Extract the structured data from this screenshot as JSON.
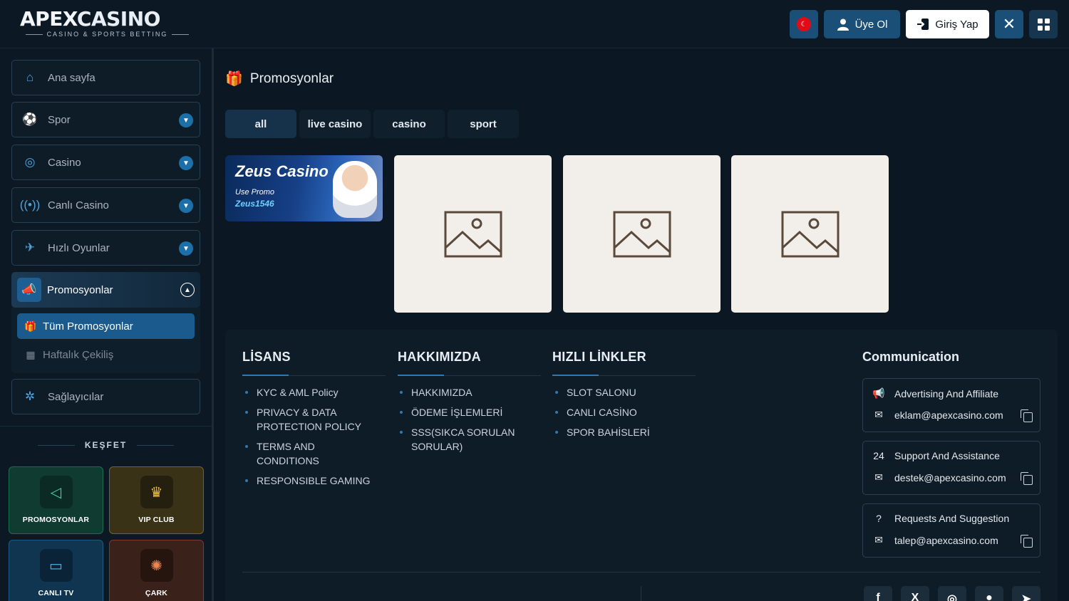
{
  "header": {
    "logo": {
      "brand_main": "APEX",
      "brand_accent": "CASINO",
      "tagline": "CASINO & SPORTS BETTING"
    },
    "language_flag_icon": "turkey-flag-icon",
    "signup_label": "Üye Ol",
    "login_label": "Giriş Yap"
  },
  "sidebar": {
    "items": [
      {
        "label": "Ana sayfa",
        "icon": "home-icon"
      },
      {
        "label": "Spor",
        "icon": "sport-icon"
      },
      {
        "label": "Casino",
        "icon": "casino-chip-icon"
      },
      {
        "label": "Canlı Casino",
        "icon": "live-broadcast-icon"
      },
      {
        "label": "Hızlı Oyunlar",
        "icon": "airplane-icon"
      },
      {
        "label": "Promosyonlar",
        "icon": "megaphone-icon"
      },
      {
        "label": "Sağlayıcılar",
        "icon": "network-icon"
      }
    ],
    "sub_items": [
      {
        "label": "Tüm Promosyonlar",
        "icon": "gift-icon"
      },
      {
        "label": "Haftalık Çekiliş",
        "icon": "ticket-icon"
      }
    ],
    "discover_label": "KEŞFET",
    "tiles": [
      {
        "label": "PROMOSYONLAR",
        "icon": "megaphone-icon"
      },
      {
        "label": "VIP CLUB",
        "icon": "crown-icon"
      },
      {
        "label": "CANLI TV",
        "icon": "tv-icon"
      },
      {
        "label": "ÇARK",
        "icon": "wheel-icon"
      }
    ]
  },
  "main": {
    "title": "Promosyonlar",
    "tabs": [
      "all",
      "live casino",
      "casino",
      "sport"
    ],
    "active_tab": "all",
    "promo_banner": {
      "title": "Zeus Casino",
      "subtitle": "Use Promo",
      "code": "Zeus1546"
    }
  },
  "footer": {
    "columns": [
      {
        "title": "LİSANS",
        "links": [
          "KYC & AML Policy",
          "PRIVACY & DATA PROTECTION POLICY",
          "TERMS AND CONDITIONS",
          "RESPONSIBLE GAMING"
        ]
      },
      {
        "title": "HAKKIMIZDA",
        "links": [
          "HAKKIMIZDA",
          "ÖDEME İŞLEMLERİ",
          "SSS(SIKCA SORULAN SORULAR)"
        ]
      },
      {
        "title": "HIZLI LİNKLER",
        "links": [
          "SLOT SALONU",
          "CANLI CASİNO",
          "SPOR BAHİSLERİ"
        ]
      }
    ],
    "communication": {
      "title": "Communication",
      "boxes": [
        {
          "label": "Advertising And Affiliate",
          "email": "eklam@apexcasino.com",
          "icon": "megaphone-icon"
        },
        {
          "label": "Support And Assistance",
          "email": "destek@apexcasino.com",
          "icon": "support-24-icon"
        },
        {
          "label": "Requests And Suggestion",
          "email": "talep@apexcasino.com",
          "icon": "question-icon"
        }
      ]
    },
    "social_icons": [
      "facebook-icon",
      "x-icon",
      "instagram-icon",
      "whatsapp-icon",
      "telegram-icon"
    ]
  },
  "colors": {
    "accent": "#1a5077",
    "background": "#0b1722",
    "active_item": "#1a5a8c"
  }
}
